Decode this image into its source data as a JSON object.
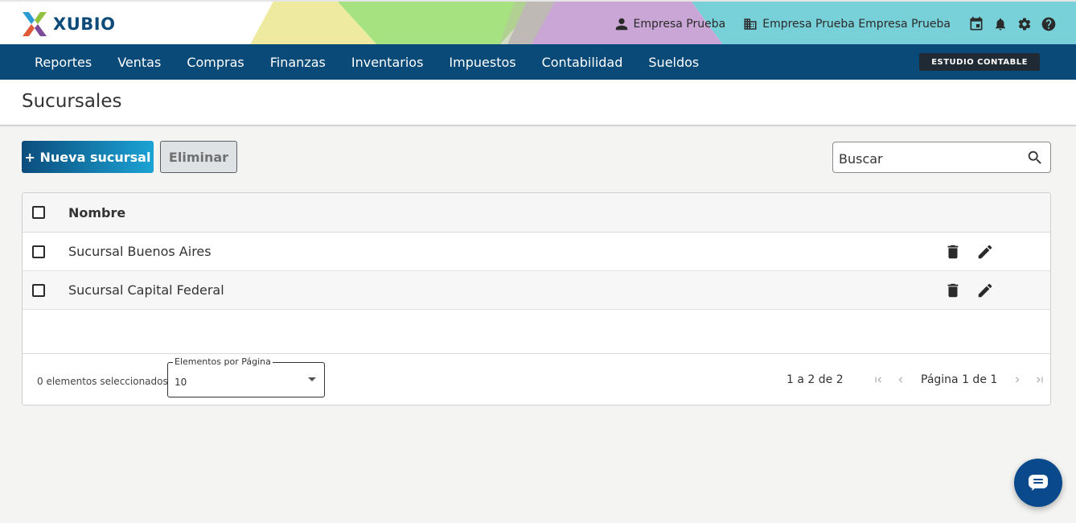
{
  "brand": {
    "name": "XUBIO"
  },
  "header": {
    "user": "Empresa Prueba",
    "company": "Empresa Prueba Empresa Prueba",
    "icons": [
      "calendar-icon",
      "bell-icon",
      "gear-icon",
      "help-icon"
    ]
  },
  "nav": {
    "items": [
      "Reportes",
      "Ventas",
      "Compras",
      "Finanzas",
      "Inventarios",
      "Impuestos",
      "Contabilidad",
      "Sueldos"
    ],
    "badge": "ESTUDIO CONTABLE"
  },
  "page": {
    "title": "Sucursales"
  },
  "actions": {
    "new_label": "+ Nueva sucursal",
    "delete_label": "Eliminar"
  },
  "search": {
    "placeholder": "Buscar"
  },
  "table": {
    "header": "Nombre",
    "rows": [
      {
        "name": "Sucursal Buenos Aires"
      },
      {
        "name": "Sucursal Capital Federal"
      }
    ]
  },
  "footer": {
    "selected": "0 elementos seleccionados",
    "per_page_label": "Elementos por Página",
    "per_page_value": "10",
    "range": "1 a 2 de 2",
    "page_label": "Página 1 de 1"
  },
  "colors": {
    "nav": "#0a4a78",
    "primary_from": "#0b4d7d",
    "primary_to": "#1ba3d4",
    "chat": "#0a4a8c"
  }
}
